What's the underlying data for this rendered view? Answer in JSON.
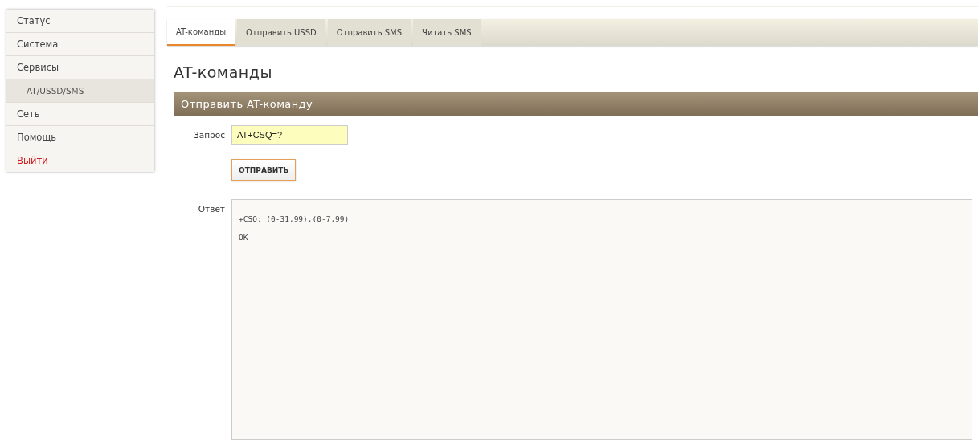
{
  "sidebar": {
    "items": [
      {
        "label": "Статус",
        "kind": "item",
        "selected": false
      },
      {
        "label": "Система",
        "kind": "item",
        "selected": false
      },
      {
        "label": "Сервисы",
        "kind": "item",
        "selected": false
      },
      {
        "label": "AT/USSD/SMS",
        "kind": "subitem",
        "selected": true
      },
      {
        "label": "Сеть",
        "kind": "item",
        "selected": false
      },
      {
        "label": "Помощь",
        "kind": "item",
        "selected": false
      },
      {
        "label": "Выйти",
        "kind": "logout",
        "selected": false
      }
    ]
  },
  "tabs": [
    {
      "label": "AT-команды",
      "selected": true
    },
    {
      "label": "Отправить USSD",
      "selected": false
    },
    {
      "label": "Отправить SMS",
      "selected": false
    },
    {
      "label": "Читать SMS",
      "selected": false
    }
  ],
  "page_title": "AT-команды",
  "panel": {
    "title": "Отправить AT-команду",
    "request_label": "Запрос",
    "request_value": "AT+CSQ=?",
    "send_button": "ОТПРАВИТЬ",
    "response_label": "Ответ",
    "response_lines": [
      "+CSQ: (0-31,99),(0-7,99)",
      "OK"
    ]
  }
}
